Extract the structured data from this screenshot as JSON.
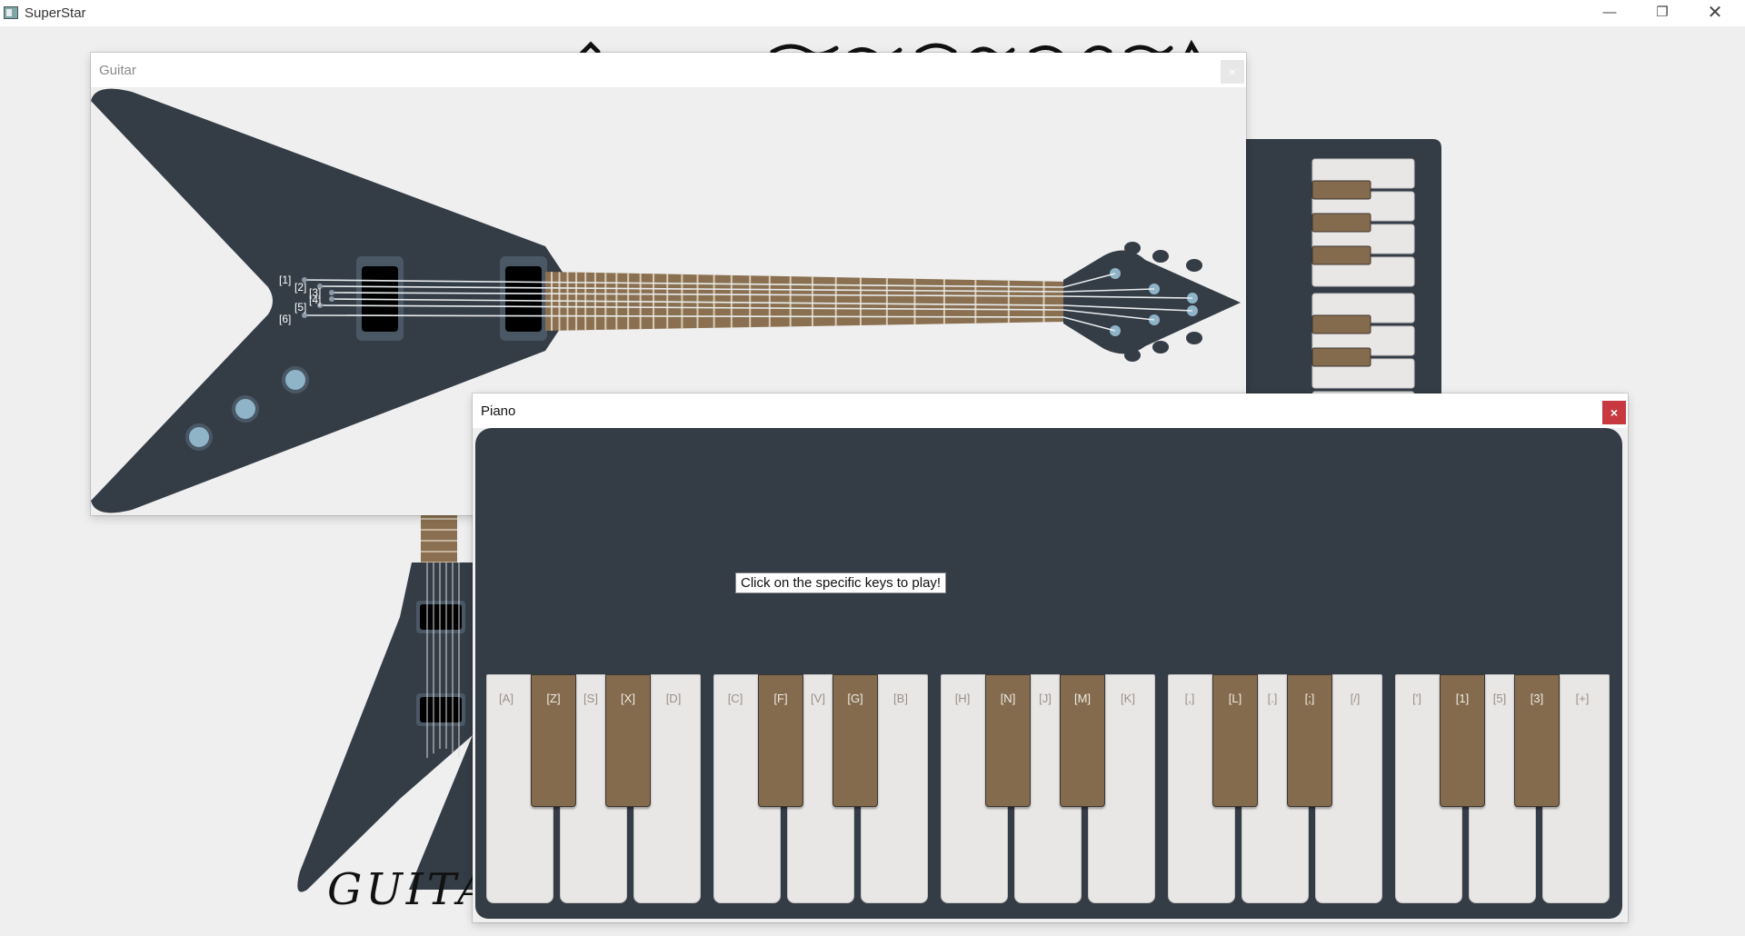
{
  "window": {
    "title": "SuperStar",
    "minimize_glyph": "—",
    "maximize_glyph": "❐",
    "close_glyph": "✕"
  },
  "background": {
    "guitar_logo_text": "GUITAR"
  },
  "guitar_window": {
    "title": "Guitar",
    "close_glyph": "×",
    "string_labels": [
      "[1]",
      "[2]",
      "[3]",
      "[4]",
      "[5]",
      "[6]"
    ]
  },
  "piano_window": {
    "title": "Piano",
    "close_glyph": "×",
    "hint": "Click on the specific keys to play!",
    "key_labels": [
      "[A]",
      "[Z]",
      "[S]",
      "[X]",
      "[D]",
      "[C]",
      "[F]",
      "[V]",
      "[G]",
      "[B]",
      "[H]",
      "[N]",
      "[J]",
      "[M]",
      "[K]",
      "[,]",
      "[L]",
      "[.]",
      "[;]",
      "[/]",
      "[']",
      "[1]",
      "[5]",
      "[3]",
      "[+]"
    ]
  },
  "colors": {
    "body_dark": "#343c46",
    "fretboard": "#8a7050",
    "black_key": "#846b4e",
    "white_key": "#e9e7e6",
    "knob": "#8fb4c8",
    "close_red": "#c8393f"
  }
}
